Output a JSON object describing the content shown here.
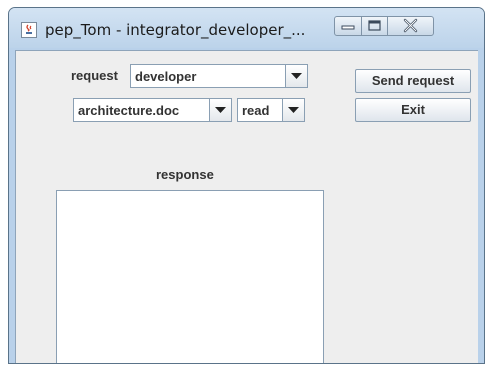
{
  "window": {
    "title": "pep_Tom - integrator_developer_...",
    "icon": "java-app-icon",
    "controls": [
      "minimize-icon",
      "maximize-icon",
      "close-icon"
    ]
  },
  "form": {
    "request_label": "request",
    "request_selected": "developer",
    "document_selected": "architecture.doc",
    "action_selected": "read",
    "response_label": "response",
    "response_text": ""
  },
  "buttons": {
    "send": "Send request",
    "exit": "Exit"
  },
  "colors": {
    "titlebar": "#bcd3ea",
    "client_bg": "#eeeeee",
    "border": "#8a9fb3"
  }
}
